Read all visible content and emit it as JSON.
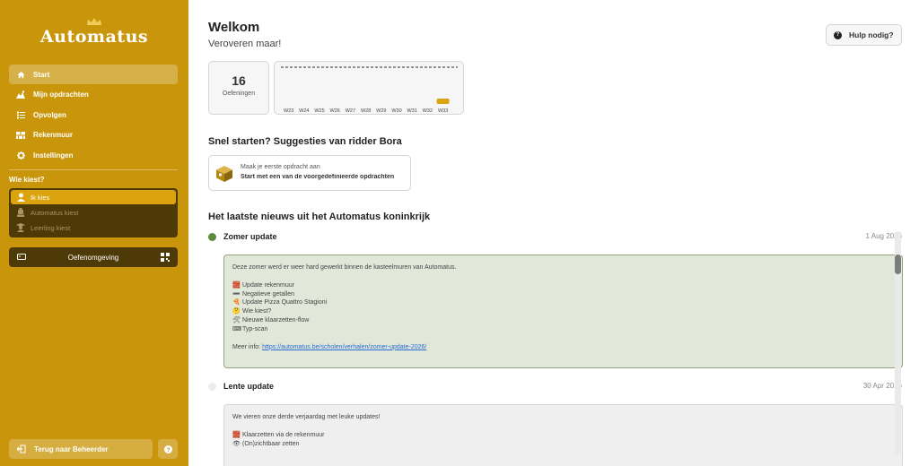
{
  "brand": {
    "name": "Automatus",
    "accent": "#c9960b",
    "dark": "#4e3a07"
  },
  "sidebar": {
    "nav": [
      {
        "label": "Start",
        "icon": "home-icon",
        "active": true
      },
      {
        "label": "Mijn opdrachten",
        "icon": "tasks-icon",
        "active": false
      },
      {
        "label": "Opvolgen",
        "icon": "list-icon",
        "active": false
      },
      {
        "label": "Rekenmuur",
        "icon": "wall-icon",
        "active": false
      },
      {
        "label": "Instellingen",
        "icon": "gear-icon",
        "active": false
      }
    ],
    "who_title": "Wie kiest?",
    "who_options": [
      {
        "label": "Ik kies",
        "icon": "teacher-icon",
        "active": true
      },
      {
        "label": "Automatus kiest",
        "icon": "robot-icon",
        "active": false
      },
      {
        "label": "Leerling kiest",
        "icon": "student-icon",
        "active": false
      }
    ],
    "env_button": "Oefenomgeving",
    "back_button": "Terug naar Beheerder"
  },
  "header": {
    "title": "Welkom",
    "subtitle": "Veroveren maar!",
    "help_button": "Hulp nodig?"
  },
  "stats": {
    "value": "16",
    "label": "Oefeningen"
  },
  "chart_data": {
    "type": "bar",
    "categories": [
      "W23",
      "W24",
      "W25",
      "W26",
      "W27",
      "W28",
      "W29",
      "W30",
      "W31",
      "W32",
      "W33"
    ],
    "values": [
      0,
      0,
      0,
      0,
      0,
      0,
      0,
      0,
      0,
      0,
      16
    ],
    "target_line": true,
    "bar_color": "#dba30e"
  },
  "suggestions": {
    "title": "Snel starten? Suggesties van ridder Bora",
    "card_line1": "Maak je eerste opdracht aan",
    "card_line2": "Start met een van de voorgedefinieerde opdrachten"
  },
  "news": {
    "title": "Het laatste nieuws uit het Automatus koninkrijk",
    "items": [
      {
        "title": "Zomer update",
        "date": "1 Aug 2026",
        "intro": "Deze zomer werd er weer hard gewerkt binnen de kasteelmuren van Automatus.",
        "bullets": [
          {
            "emoji": "🧱",
            "text": "Update rekenmuur"
          },
          {
            "emoji": "➖",
            "text": "Negatieve getallen"
          },
          {
            "emoji": "🍕",
            "text": "Update Pizza Quattro Stagioni"
          },
          {
            "emoji": "🤔",
            "text": "Wie kiest?"
          },
          {
            "emoji": "🛠",
            "text": "Nieuwe klaarzetten-flow"
          },
          {
            "emoji": "⌨",
            "text": "Typ-scan"
          }
        ],
        "more_label": "Meer info:",
        "more_link": "https://automatus.be/scholen/verhalen/zomer-update-2026/"
      },
      {
        "title": "Lente update",
        "date": "30 Apr 2026",
        "intro": "We vieren onze derde verjaardag met leuke updates!",
        "bullets": [
          {
            "emoji": "🧱",
            "text": "Klaarzetten via de rekenmuur"
          },
          {
            "emoji": "👁",
            "text": "(On)zichtbaar zetten"
          }
        ]
      }
    ]
  }
}
